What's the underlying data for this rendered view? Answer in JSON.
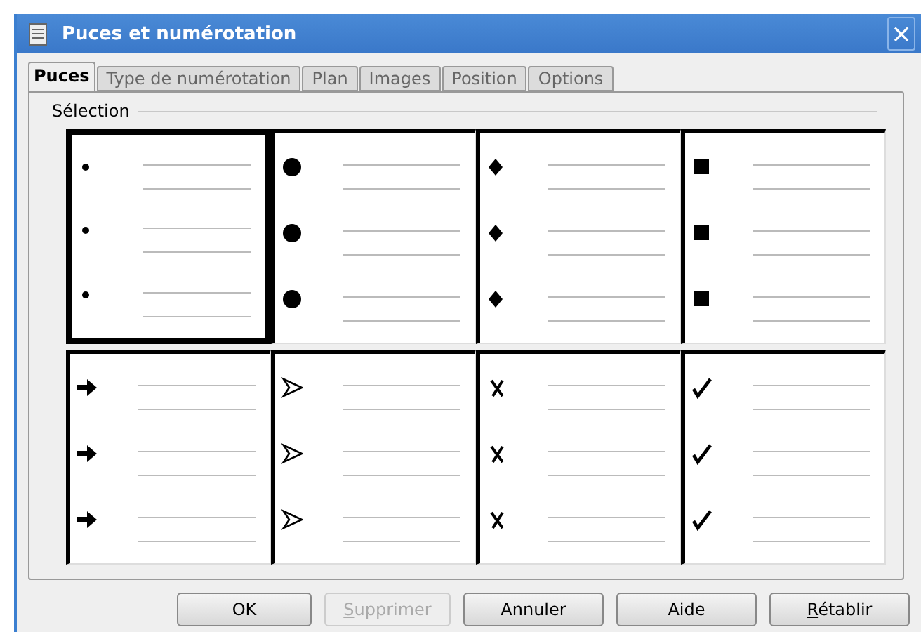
{
  "window": {
    "title": "Puces et numérotation",
    "close": "×"
  },
  "tabs": [
    {
      "label": "Puces",
      "selected": true
    },
    {
      "label": "Type de numérotation",
      "selected": false
    },
    {
      "label": "Plan",
      "selected": false
    },
    {
      "label": "Images",
      "selected": false
    },
    {
      "label": "Position",
      "selected": false
    },
    {
      "label": "Options",
      "selected": false
    }
  ],
  "section": {
    "title": "Sélection"
  },
  "bullet_styles": [
    {
      "kind": "small-dot",
      "selected": true
    },
    {
      "kind": "large-dot",
      "selected": false
    },
    {
      "kind": "diamond",
      "selected": false
    },
    {
      "kind": "square",
      "selected": false
    },
    {
      "kind": "arrow",
      "selected": false
    },
    {
      "kind": "arrowhead",
      "selected": false
    },
    {
      "kind": "cross",
      "selected": false
    },
    {
      "kind": "check",
      "selected": false
    }
  ],
  "buttons": [
    {
      "label": "OK",
      "disabled": false,
      "mnemonic": false
    },
    {
      "label": "Supprimer",
      "disabled": true,
      "mnemonic": true
    },
    {
      "label": "Annuler",
      "disabled": false,
      "mnemonic": false
    },
    {
      "label": "Aide",
      "disabled": false,
      "mnemonic": false
    },
    {
      "label": "Rétablir",
      "disabled": false,
      "mnemonic": true
    }
  ]
}
